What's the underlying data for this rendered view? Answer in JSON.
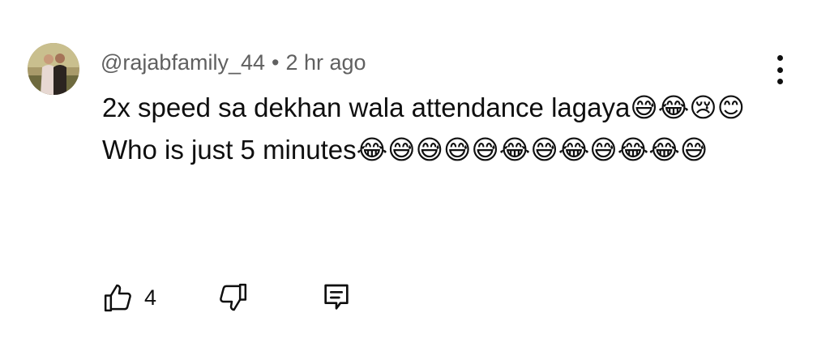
{
  "comment": {
    "author": "@rajabfamily_44",
    "separator": "•",
    "timestamp": "2 hr ago",
    "lines": [
      "2x speed sa dekhan wala attendance lagaya😅😂😢😊",
      "Who is just 5 minutes😂😅😅😅😅😂😅😂😅😂😂😅"
    ],
    "like_count": "4"
  },
  "icons": {
    "avatar": "avatar",
    "menu": "more-vert-icon",
    "like": "thumbs-up-icon",
    "dislike": "thumbs-down-icon",
    "reply": "reply-comment-icon"
  }
}
